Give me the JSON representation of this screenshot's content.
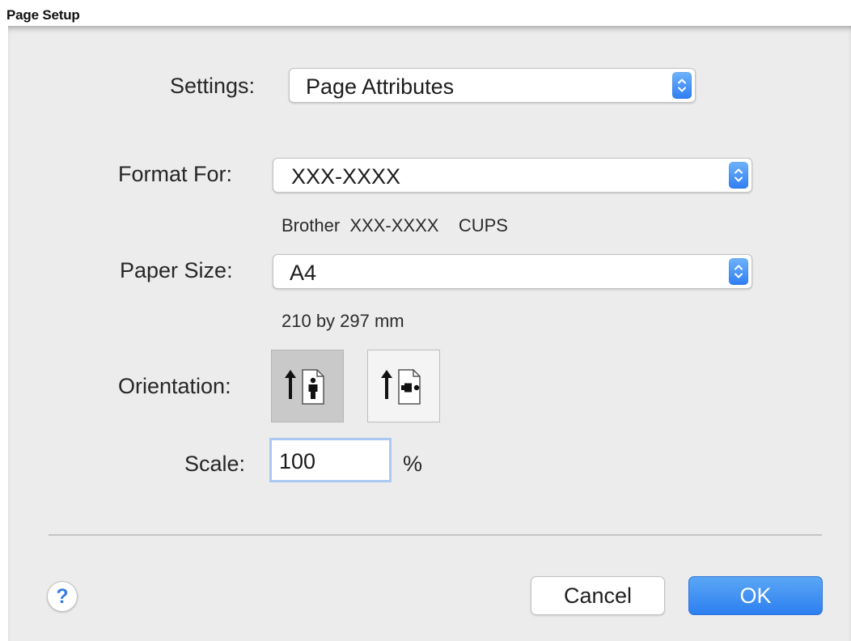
{
  "document": {
    "title": "Page Setup"
  },
  "settings": {
    "label": "Settings:",
    "value": "Page Attributes"
  },
  "format_for": {
    "label": "Format For:",
    "value": "XXX-XXXX",
    "printer_description": "Brother  XXX-XXXX    CUPS"
  },
  "paper_size": {
    "label": "Paper Size:",
    "value": "A4",
    "dimensions": "210 by 297 mm"
  },
  "orientation": {
    "label": "Orientation:",
    "options": [
      {
        "icon": "portrait-orientation-icon",
        "selected": true
      },
      {
        "icon": "landscape-orientation-icon",
        "selected": false
      }
    ]
  },
  "scale": {
    "label": "Scale:",
    "value": "100",
    "unit": "%"
  },
  "footer": {
    "help_label": "?",
    "cancel_label": "Cancel",
    "ok_label": "OK"
  },
  "colors": {
    "accent": "#2f7ef4",
    "ok_button": "#3b8cf2",
    "dialog_background": "#ececec",
    "focus_ring": "#a9c9f2"
  }
}
